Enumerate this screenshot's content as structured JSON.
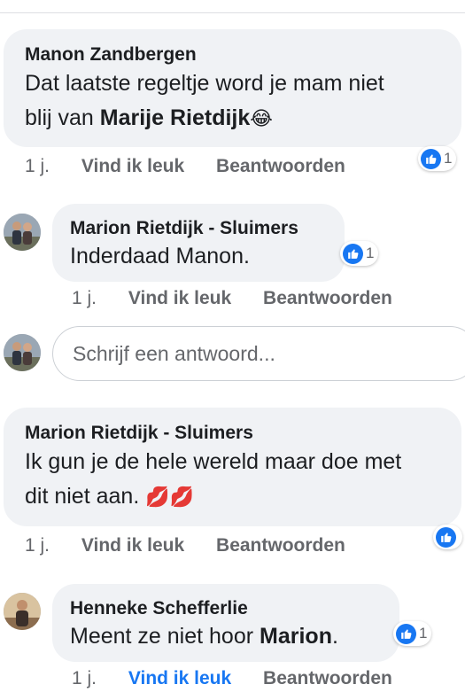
{
  "comments": [
    {
      "author": "Manon Zandbergen",
      "text_line1": "Dat laatste regeltje word je mam niet",
      "text_line2_prefix": "blij van ",
      "mention": "Marije Rietdijk",
      "emoji": "😂",
      "reaction_count": "1",
      "time": "1 j.",
      "like_label": "Vind ik leuk",
      "reply_label": "Beantwoorden"
    },
    {
      "author": "Marion Rietdijk - Sluimers",
      "text": "Inderdaad Manon.",
      "reaction_count": "1",
      "time": "1 j.",
      "like_label": "Vind ik leuk",
      "reply_label": "Beantwoorden"
    },
    {
      "author": "Marion Rietdijk - Sluimers",
      "text_line1": "Ik gun je de hele wereld maar doe met",
      "text_line2": "dit niet aan.",
      "emoji": "💋💋",
      "time": "1 j.",
      "like_label": "Vind ik leuk",
      "reply_label": "Beantwoorden"
    },
    {
      "author": "Henneke Schefferlie",
      "text_prefix": "Meent ze niet hoor ",
      "mention": "Marion",
      "text_suffix": ".",
      "reaction_count": "1",
      "time": "1 j.",
      "like_label": "Vind ik leuk",
      "like_active": true,
      "reply_label": "Beantwoorden"
    }
  ],
  "reply_input": {
    "placeholder": "Schrijf een antwoord..."
  },
  "colors": {
    "accent": "#1877f2",
    "bubble": "#f0f2f5",
    "meta": "#65676b",
    "lips": "#e0245e"
  }
}
